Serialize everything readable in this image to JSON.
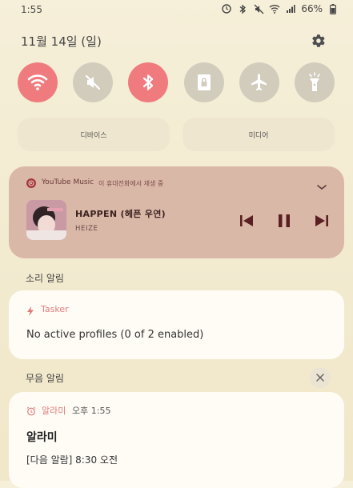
{
  "status_bar": {
    "time": "1:55",
    "battery": "66%",
    "icons": [
      "alarm-icon",
      "bluetooth-icon",
      "mute-icon",
      "wifi-icon",
      "signal-icon",
      "battery-icon"
    ]
  },
  "header": {
    "date": "11월 14일 (일)"
  },
  "quick_settings": {
    "tiles": [
      {
        "name": "wifi",
        "state": "on"
      },
      {
        "name": "sound",
        "state": "muted"
      },
      {
        "name": "bluetooth",
        "state": "on"
      },
      {
        "name": "lock",
        "state": "off"
      },
      {
        "name": "airplane",
        "state": "off"
      },
      {
        "name": "flashlight",
        "state": "off"
      }
    ],
    "colors": {
      "on": "#f07b7f",
      "off": "#d2ccbd"
    }
  },
  "pills": {
    "devices": "디바이스",
    "media": "미디어"
  },
  "media": {
    "app": "YouTube Music",
    "device": "이 휴대전화에서 재생 중",
    "song": "HAPPEN (헤픈 우연)",
    "artist": "HEIZE",
    "card_color": "#dab8a8"
  },
  "sections": {
    "sound_alerts": "소리 알림",
    "silent_alerts": "무음 알림"
  },
  "tasker": {
    "app": "Tasker",
    "message": "No active profiles (0 of 2 enabled)"
  },
  "alarm": {
    "app": "알라미",
    "time": "오후 1:55",
    "title": "알라미",
    "message": "[다음 알람] 8:30 오전"
  }
}
